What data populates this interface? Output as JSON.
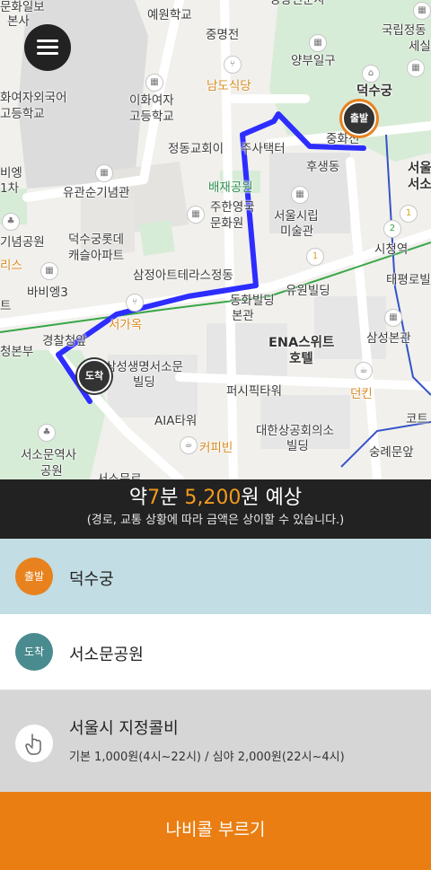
{
  "map": {
    "labels": {
      "l1": "문화일보",
      "l2": "본사",
      "l3": "예원학교",
      "l4": "중명전",
      "l5": "경향신문사",
      "l6": "국립정동",
      "l7": "세실",
      "l8": "양부일구",
      "l9": "덕수궁",
      "l10": "화여자외국어",
      "l11": "고등학교",
      "l12": "이화여자",
      "l13": "고등학교",
      "l14": "남도식당",
      "l15": "정동교회이",
      "l16": "주사택터",
      "l17": "중화전",
      "l18": "후생동",
      "l19": "서울",
      "l20": "서소",
      "l21": "비엥",
      "l22": "1차",
      "l23": "유관순기념관",
      "l24": "배재공원",
      "l25": "주한영국",
      "l26": "문화원",
      "l27": "서울시립",
      "l28": "미술관",
      "l29": "기념공원",
      "l30": "덕수궁롯데",
      "l31": "캐슬아파트",
      "l32": "시청역",
      "l33": "리스",
      "l34": "삼정아트테라스정동",
      "l35": "태평로빌",
      "l36": "바비엥3",
      "l37": "유원빌딩",
      "l38": "트",
      "l39": "동화빌딩",
      "l40": "본관",
      "l41": "삼성본관",
      "l42": "서가옥",
      "l43": "경찰청앞",
      "l44": "청본부",
      "l45": "ENA스위트",
      "l46": "호텔",
      "l47": "삼성생명서소문",
      "l48": "빌딩",
      "l49": "던킨",
      "l50": "퍼시픽타워",
      "l51": "코트",
      "l52": "AIA타워",
      "l53": "대한상공회의소",
      "l54": "빌딩",
      "l55": "서소문역사",
      "l56": "공원",
      "l57": "커피빈",
      "l58": "숭례문앞",
      "l59": "서소문로"
    },
    "pin_start": "출발",
    "pin_end": "도착"
  },
  "estimate": {
    "prefix": "약",
    "minutes": "7",
    "min_unit": "분",
    "price": "5,200",
    "suffix": "원 예상",
    "note": "(경로, 교통 상황에 따라 금액은 상이할 수 있습니다.)"
  },
  "start": {
    "badge": "출발",
    "place": "덕수궁"
  },
  "end": {
    "badge": "도착",
    "place": "서소문공원"
  },
  "fee": {
    "title": "서울시 지정콜비",
    "detail": "기본 1,000원(4시~22시) / 심야 2,000원(22시~4시)"
  },
  "call_button": "나비콜 부르기",
  "colors": {
    "accent": "#ea7e12",
    "route": "#2d2dff",
    "start_row": "#c2dde3",
    "fee_row": "#d6d6d6"
  }
}
